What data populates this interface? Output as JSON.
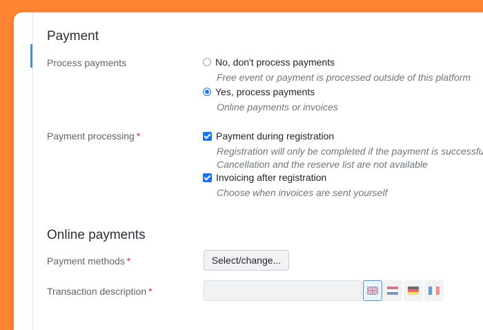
{
  "sections": {
    "payment": {
      "heading": "Payment",
      "process_payments": {
        "label": "Process payments",
        "options": [
          {
            "title": "No, don't process payments",
            "desc": "Free event or payment is processed outside of this platform",
            "checked": false
          },
          {
            "title": "Yes, process payments",
            "desc": "Online payments or invoices",
            "checked": true
          }
        ]
      },
      "payment_processing": {
        "label": "Payment processing",
        "required_mark": "*",
        "options": [
          {
            "title": "Payment during registration",
            "desc_line1": "Registration will only be completed if the payment is successful.",
            "desc_line2": "Cancellation and the reserve list are not available",
            "checked": true
          },
          {
            "title": "Invoicing after registration",
            "desc": "Choose when invoices are sent yourself",
            "checked": true
          }
        ]
      }
    },
    "online_payments": {
      "heading": "Online payments",
      "payment_methods": {
        "label": "Payment methods",
        "required_mark": "*",
        "button_label": "Select/change..."
      },
      "transaction_description": {
        "label": "Transaction description",
        "required_mark": "*",
        "value": "",
        "languages": [
          {
            "icon": "flag-uk-icon",
            "active": true
          },
          {
            "icon": "flag-nl-icon",
            "active": false
          },
          {
            "icon": "flag-de-icon",
            "active": false
          },
          {
            "icon": "flag-fr-icon",
            "active": false
          }
        ]
      }
    }
  },
  "colors": {
    "page_background": "#FF8533",
    "accent": "#1A73E8",
    "required": "#D62D2D",
    "section_marker": "#4A90C8"
  }
}
